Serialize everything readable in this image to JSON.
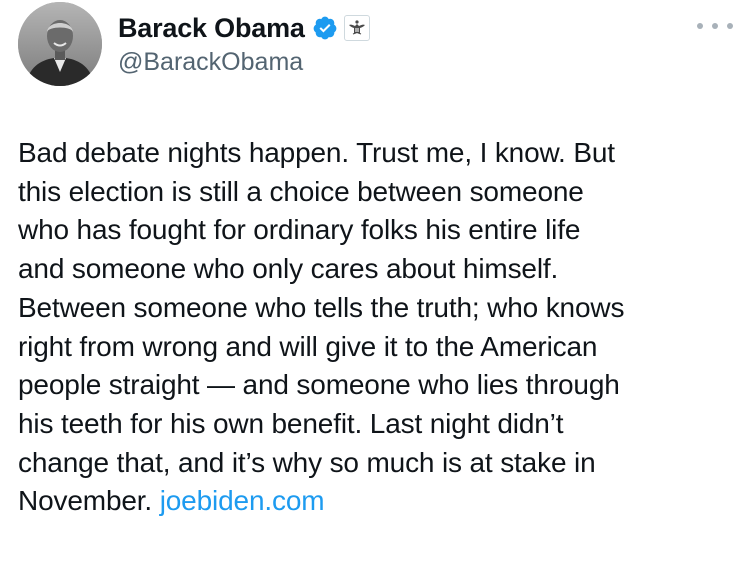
{
  "author": {
    "display_name": "Barack Obama",
    "handle": "@BarackObama",
    "verified_icon": "verified-badge-icon",
    "affiliation_icon": "government-seal-icon"
  },
  "menu": {
    "icon": "more-options-icon"
  },
  "tweet": {
    "lines": [
      "Bad debate nights happen. Trust me, I know. But",
      "this election is still a choice between someone",
      "who has fought for ordinary folks his entire life",
      "and someone who only cares about himself.",
      "Between someone who tells the truth; who knows",
      "right from wrong and will give it to the American",
      "people straight — and someone who lies through",
      "his teeth for his own benefit. Last night didn’t",
      "change that, and it’s why so much is at stake in"
    ],
    "last_line_text": "November.",
    "link_text": "joebiden.com"
  },
  "colors": {
    "text": "#0f1419",
    "secondary": "#536471",
    "link": "#1d9bf0",
    "verified": "#1d9bf0"
  }
}
